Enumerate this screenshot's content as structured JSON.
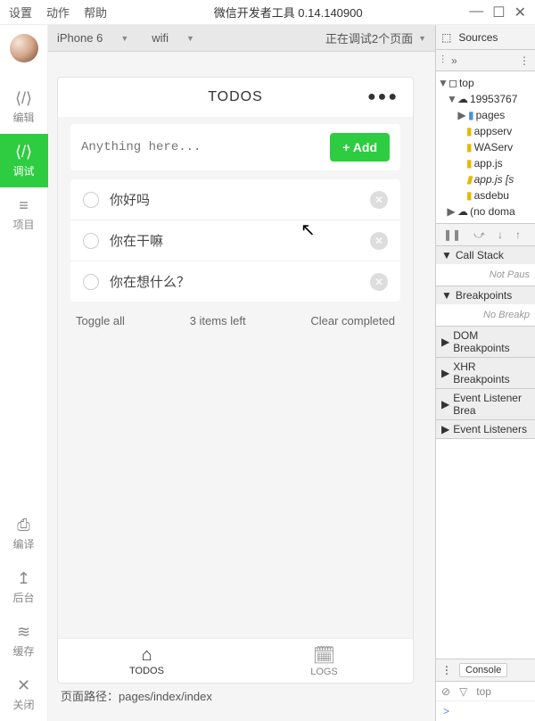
{
  "titlebar": {
    "menus": [
      "设置",
      "动作",
      "帮助"
    ],
    "title": "微信开发者工具 0.14.140900"
  },
  "leftnav": {
    "items": [
      {
        "icon": "⟨/⟩",
        "label": "编辑"
      },
      {
        "icon": "⟨/⟩",
        "label": "调试",
        "active": true
      },
      {
        "icon": "≡",
        "label": "项目"
      }
    ],
    "bottom": [
      {
        "icon": "⎙",
        "label": "编译"
      },
      {
        "icon": "↥",
        "label": "后台"
      },
      {
        "icon": "≋",
        "label": "缓存"
      },
      {
        "icon": "✕",
        "label": "关闭"
      }
    ]
  },
  "toolbar": {
    "device": "iPhone 6",
    "network": "wifi",
    "debug": "正在调试2个页面"
  },
  "simulator": {
    "title": "TODOS",
    "input_placeholder": "Anything here...",
    "add_btn": "+ Add",
    "todos": [
      "你好吗",
      "你在干嘛",
      "你在想什么？"
    ],
    "footer": {
      "toggle": "Toggle all",
      "count": "3 items left",
      "clear": "Clear completed"
    },
    "tabs": [
      {
        "icon": "⌂",
        "label": "TODOS",
        "active": true
      },
      {
        "icon": "🗓",
        "label": "LOGS"
      }
    ],
    "path_label": "页面路径：",
    "path": "pages/index/index"
  },
  "devtools": {
    "tab": "Sources",
    "tree": {
      "root": "top",
      "domain": "19953767",
      "pages": "pages",
      "files": [
        "appserv",
        "WAServ",
        "app.js",
        "app.js [s",
        "asdebu"
      ],
      "nodomain": "(no doma"
    },
    "sections": {
      "callstack": "Call Stack",
      "callstack_body": "Not Paus",
      "breakpoints": "Breakpoints",
      "breakpoints_body": "No Breakp",
      "dom": "DOM Breakpoints",
      "xhr": "XHR Breakpoints",
      "evlistbp": "Event Listener Brea",
      "evlist": "Event Listeners"
    },
    "console": {
      "btn": "Console",
      "scope": "top",
      "prompt": ">"
    }
  }
}
